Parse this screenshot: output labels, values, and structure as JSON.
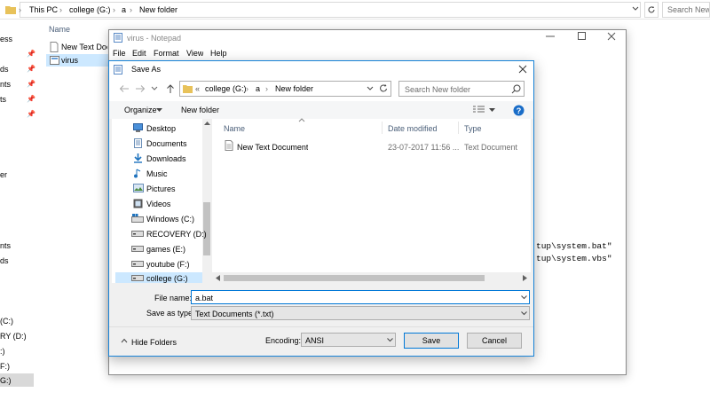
{
  "explorer": {
    "breadcrumb": [
      "This PC",
      "college (G:)",
      "a",
      "New folder"
    ],
    "search_placeholder": "Search New f",
    "column_name": "Name",
    "files": [
      {
        "name": "New Text Docu"
      },
      {
        "name": "virus"
      }
    ],
    "nav_fragments": [
      "ess",
      "ds",
      "nts",
      "ts",
      "er",
      "nts",
      "ds",
      "(C:)",
      "RY (D:)",
      ":)",
      "F:)",
      "G:)"
    ]
  },
  "notepad": {
    "title": "virus - Notepad",
    "menu": [
      "File",
      "Edit",
      "Format",
      "View",
      "Help"
    ],
    "lines": [
      "tup\\system.bat\"",
      "tup\\system.vbs\""
    ]
  },
  "dialog": {
    "title": "Save As",
    "path": [
      "«",
      "college (G:)",
      "a",
      "New folder"
    ],
    "search_placeholder": "Search New folder",
    "organize_label": "Organize",
    "new_folder_label": "New folder",
    "tree": [
      {
        "label": "Desktop",
        "icon": "desktop-icon"
      },
      {
        "label": "Documents",
        "icon": "documents-icon"
      },
      {
        "label": "Downloads",
        "icon": "downloads-icon"
      },
      {
        "label": "Music",
        "icon": "music-icon"
      },
      {
        "label": "Pictures",
        "icon": "pictures-icon"
      },
      {
        "label": "Videos",
        "icon": "videos-icon"
      },
      {
        "label": "Windows (C:)",
        "icon": "windows-drive-icon"
      },
      {
        "label": "RECOVERY (D:)",
        "icon": "drive-icon"
      },
      {
        "label": "games (E:)",
        "icon": "drive-icon"
      },
      {
        "label": "youtube (F:)",
        "icon": "drive-icon"
      },
      {
        "label": "college (G:)",
        "icon": "drive-icon",
        "selected": true
      }
    ],
    "columns": {
      "name": "Name",
      "date": "Date modified",
      "type": "Type"
    },
    "files": [
      {
        "name": "New Text Document",
        "date": "23-07-2017 11:56 ...",
        "type": "Text Document"
      }
    ],
    "file_name_label": "File name:",
    "file_name_value": "a.bat",
    "save_type_label": "Save as type:",
    "save_type_value": "Text Documents (*.txt)",
    "hide_folders_label": "Hide Folders",
    "encoding_label": "Encoding:",
    "encoding_value": "ANSI",
    "save_label": "Save",
    "cancel_label": "Cancel"
  }
}
